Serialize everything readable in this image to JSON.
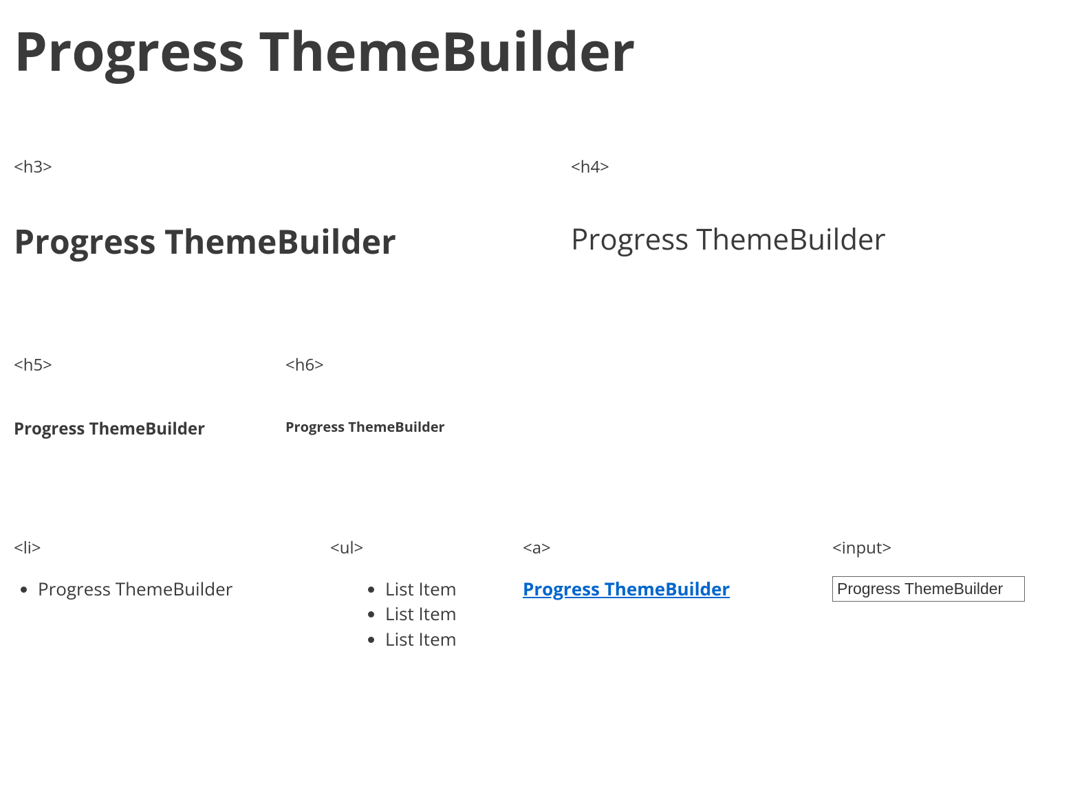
{
  "main_heading": "Progress ThemeBuilder",
  "sections": {
    "h3": {
      "tag": "<h3>",
      "sample": "Progress ThemeBuilder"
    },
    "h4": {
      "tag": "<h4>",
      "sample": "Progress ThemeBuilder"
    },
    "h5": {
      "tag": "<h5>",
      "sample": "Progress ThemeBuilder"
    },
    "h6": {
      "tag": "<h6>",
      "sample": "Progress ThemeBuilder"
    },
    "li": {
      "tag": "<li>",
      "sample": "Progress ThemeBuilder"
    },
    "ul": {
      "tag": "<ul>",
      "items": [
        "List Item",
        "List Item",
        "List Item"
      ]
    },
    "a": {
      "tag": "<a>",
      "sample": "Progress ThemeBuilder"
    },
    "input": {
      "tag": "<input>",
      "value": "Progress ThemeBuilder"
    }
  }
}
